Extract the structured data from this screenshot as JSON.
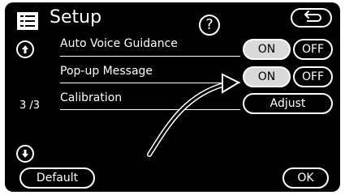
{
  "header": {
    "title": "Setup",
    "help_label": "?"
  },
  "page_indicator": "3 /3",
  "rows": [
    {
      "label": "Auto Voice Guidance",
      "on_label": "ON",
      "off_label": "OFF",
      "selected": "ON"
    },
    {
      "label": "Pop-up Message",
      "on_label": "ON",
      "off_label": "OFF",
      "selected": "ON"
    },
    {
      "label": "Calibration",
      "action_label": "Adjust"
    }
  ],
  "footer": {
    "default_label": "Default",
    "ok_label": "OK"
  },
  "icons": {
    "menu": "menu-list-icon",
    "back": "back-arrow-icon",
    "scroll_up": "scroll-up-icon",
    "scroll_down": "scroll-down-icon",
    "pointer": "curved-arrow-icon"
  }
}
